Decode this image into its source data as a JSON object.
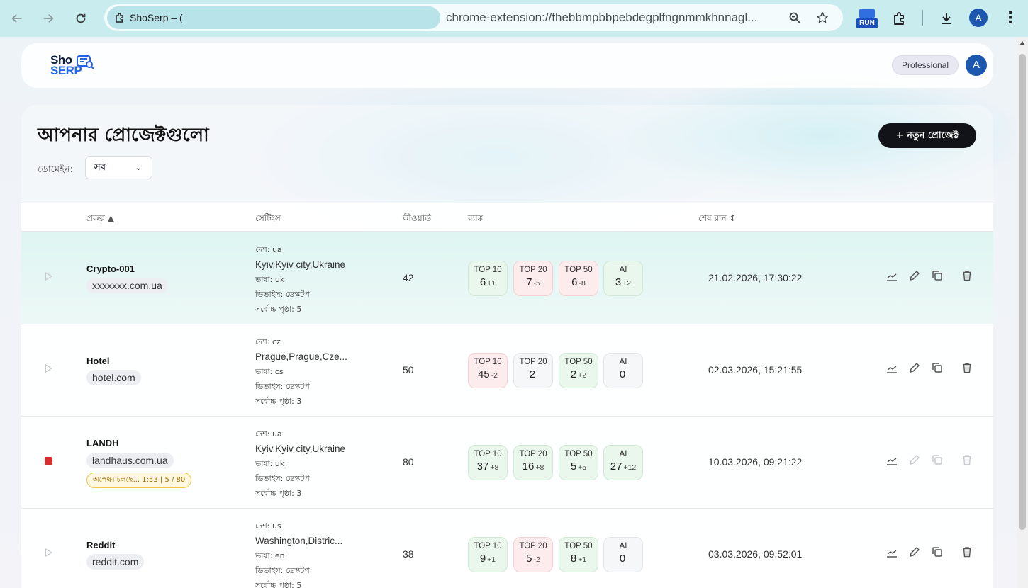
{
  "browser": {
    "tab_title": "ShoSerp – (",
    "url": "chrome-extension://fhebbmpbbpebdegplfngnmmkhnnagl...",
    "extension_badge": "RUN",
    "profile_initial": "A"
  },
  "header": {
    "logo_top": "Sho",
    "logo_bottom": "SERP",
    "plan": "Professional",
    "avatar_initial": "A"
  },
  "main": {
    "title": "আপনার প্রোজেক্টগুলো",
    "new_button": "+ নতুন প্রোজেক্ট",
    "filter_label": "ডোমেইন:",
    "filter_value": "সব"
  },
  "table": {
    "headers": {
      "project": "প্রকল্প ▲",
      "settings": "সেটিংস",
      "keywords": "কীওয়ার্ড",
      "rank": "র‍্যাঙ্ক",
      "last_run": "শেষ রান ↕"
    },
    "rows": [
      {
        "name": "Crypto-001",
        "domain": "xxxxxxx.com.ua",
        "country": "দেশ: ua",
        "location": "Kyiv,Kyiv city,Ukraine",
        "language": "ভাষা: uk",
        "device": "ডিভাইস: ডেস্কটপ",
        "max_page": "সর্বোচ্চ পৃষ্ঠা: 5",
        "keywords": "42",
        "ranks": [
          {
            "label": "TOP 10",
            "value": "6",
            "delta": "+1",
            "tone": "green"
          },
          {
            "label": "TOP 20",
            "value": "7",
            "delta": "-5",
            "tone": "red"
          },
          {
            "label": "TOP 50",
            "value": "6",
            "delta": "-8",
            "tone": "red"
          },
          {
            "label": "AI",
            "value": "3",
            "delta": "+2",
            "tone": "green"
          }
        ],
        "last_run": "21.02.2026, 17:30:22"
      },
      {
        "name": "Hotel",
        "domain": "hotel.com",
        "country": "দেশ: cz",
        "location": "Prague,Prague,Cze...",
        "language": "ভাষা: cs",
        "device": "ডিভাইস: ডেস্কটপ",
        "max_page": "সর্বোচ্চ পৃষ্ঠা: 3",
        "keywords": "50",
        "ranks": [
          {
            "label": "TOP 10",
            "value": "45",
            "delta": "-2",
            "tone": "red"
          },
          {
            "label": "TOP 20",
            "value": "2",
            "delta": "",
            "tone": "neutral"
          },
          {
            "label": "TOP 50",
            "value": "2",
            "delta": "+2",
            "tone": "green"
          },
          {
            "label": "AI",
            "value": "0",
            "delta": "",
            "tone": "neutral"
          }
        ],
        "last_run": "02.03.2026, 15:21:55"
      },
      {
        "name": "LANDH",
        "domain": "landhaus.com.ua",
        "status": "অপেক্ষা চলছে... 1:53 | 5 / 80",
        "country": "দেশ: ua",
        "location": "Kyiv,Kyiv city,Ukraine",
        "language": "ভাষা: uk",
        "device": "ডিভাইস: ডেস্কটপ",
        "max_page": "সর্বোচ্চ পৃষ্ঠা: 3",
        "keywords": "80",
        "ranks": [
          {
            "label": "TOP 10",
            "value": "37",
            "delta": "+8",
            "tone": "green"
          },
          {
            "label": "TOP 20",
            "value": "16",
            "delta": "+8",
            "tone": "green"
          },
          {
            "label": "TOP 50",
            "value": "5",
            "delta": "+5",
            "tone": "green"
          },
          {
            "label": "AI",
            "value": "27",
            "delta": "+12",
            "tone": "green"
          }
        ],
        "last_run": "10.03.2026, 09:21:22"
      },
      {
        "name": "Reddit",
        "domain": "reddit.com",
        "country": "দেশ: us",
        "location": "Washington,Distric...",
        "language": "ভাষা: en",
        "device": "ডিভাইস: ডেস্কটপ",
        "max_page": "সর্বোচ্চ পৃষ্ঠা: 5",
        "keywords": "38",
        "ranks": [
          {
            "label": "TOP 10",
            "value": "9",
            "delta": "+1",
            "tone": "green"
          },
          {
            "label": "TOP 20",
            "value": "5",
            "delta": "-2",
            "tone": "red"
          },
          {
            "label": "TOP 50",
            "value": "8",
            "delta": "+1",
            "tone": "green"
          },
          {
            "label": "AI",
            "value": "0",
            "delta": "",
            "tone": "neutral"
          }
        ],
        "last_run": "03.03.2026, 09:52:01"
      }
    ]
  }
}
